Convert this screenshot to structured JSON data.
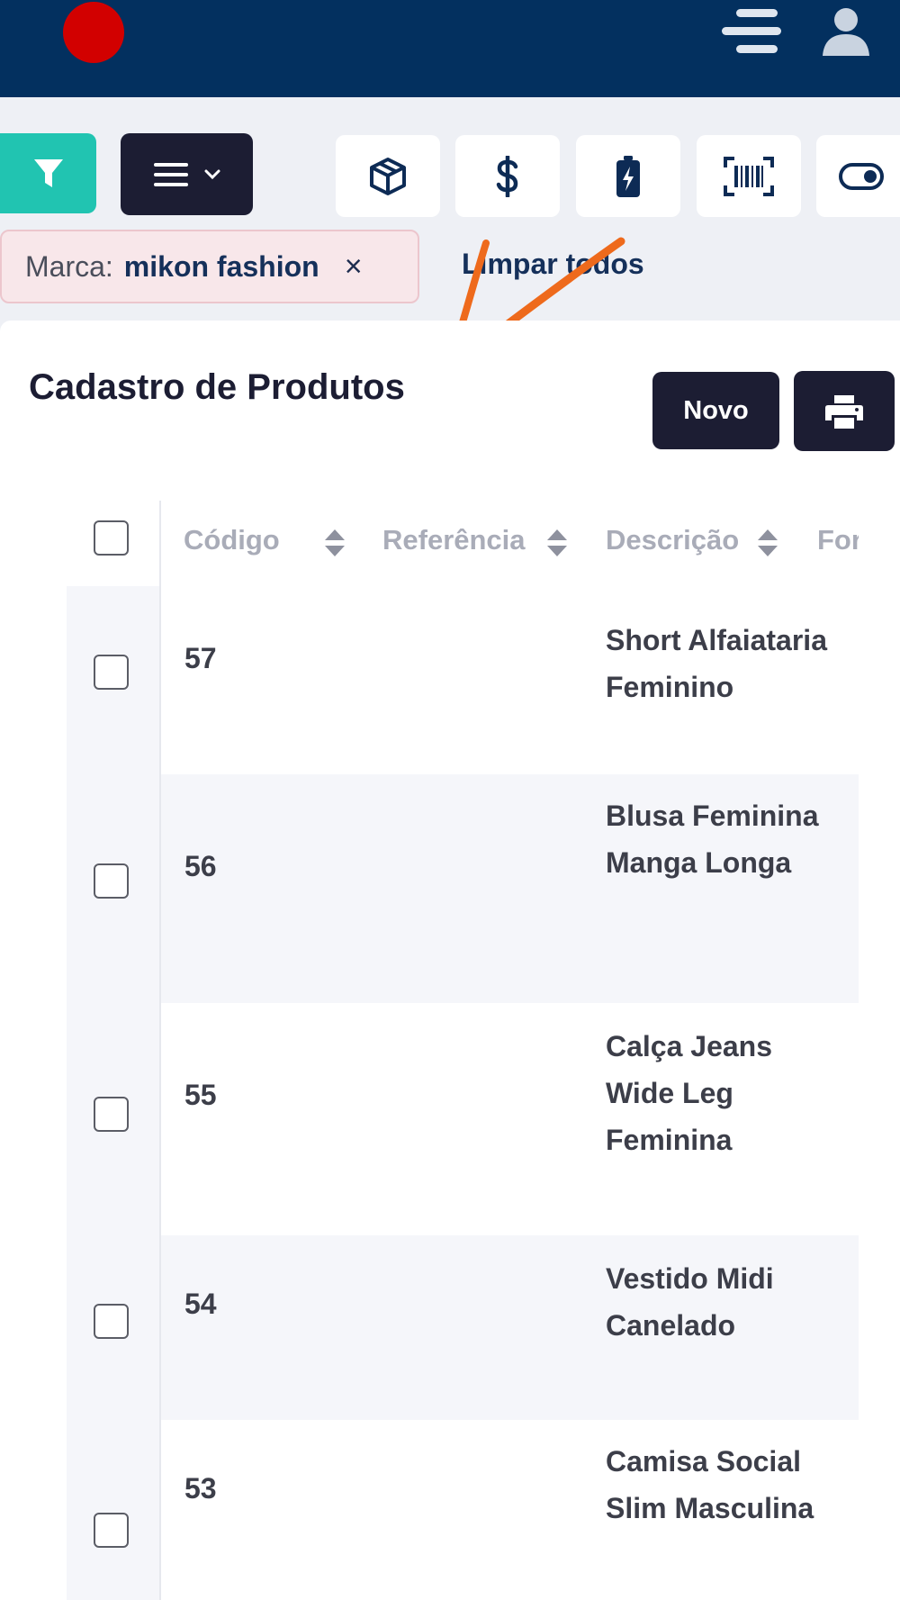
{
  "colors": {
    "header": "#03305f",
    "accent_teal": "#21c4b1",
    "dark": "#1c1d33",
    "chip_bg": "#f8e7ea",
    "annotation_arrow": "#ee6a1c"
  },
  "header": {
    "icons": [
      "record-dot",
      "menu-icon",
      "user-icon"
    ]
  },
  "toolbar": {
    "icons": [
      "filter-icon",
      "list-menu-icon",
      "box-icon",
      "dollar-icon",
      "battery-icon",
      "barcode-icon",
      "toggle-icon"
    ]
  },
  "filters": {
    "chip_label": "Marca:",
    "chip_value": "mikon fashion",
    "chip_close": "×",
    "clear_all": "Limpar todos"
  },
  "page": {
    "title": "Cadastro de Produtos",
    "new_button": "Novo"
  },
  "table": {
    "columns": [
      "Código",
      "Referência",
      "Descrição",
      "For"
    ],
    "rows": [
      {
        "code": "57",
        "reference": "",
        "description": "Short Alfaiataria Feminino"
      },
      {
        "code": "56",
        "reference": "",
        "description": "Blusa Feminina Manga Longa"
      },
      {
        "code": "55",
        "reference": "",
        "description": "Calça Jeans Wide Leg Feminina"
      },
      {
        "code": "54",
        "reference": "",
        "description": "Vestido Midi Canelado"
      },
      {
        "code": "53",
        "reference": "",
        "description": "Camisa Social Slim Masculina"
      }
    ]
  }
}
